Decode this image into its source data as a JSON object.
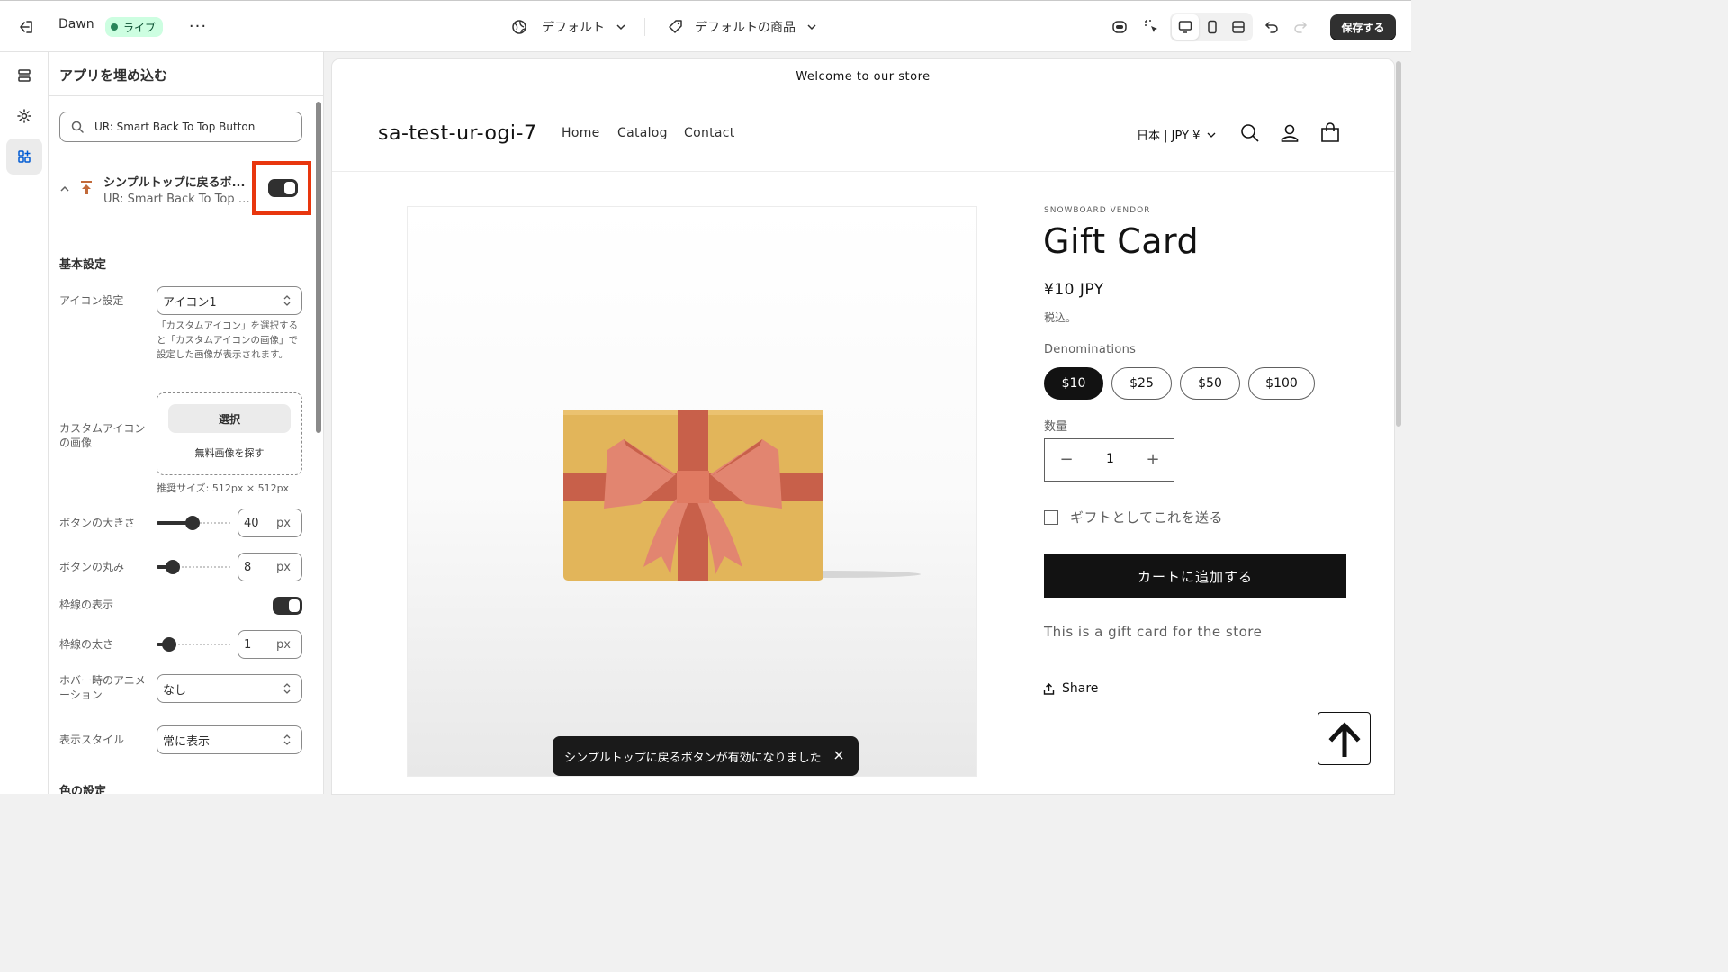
{
  "topbar": {
    "theme_name": "Dawn",
    "live_badge": "ライブ",
    "more": "···",
    "context_default": "デフォルト",
    "context_product": "デフォルトの商品",
    "save_label": "保存する"
  },
  "panel": {
    "title": "アプリを埋め込む",
    "search_value": "UR: Smart Back To Top Button",
    "app": {
      "title": "シンプルトップに戻るボ...",
      "subtitle": "UR: Smart Back To Top B...",
      "enabled": true
    },
    "basic_section": "基本設定",
    "icon_setting_label": "アイコン設定",
    "icon_setting_value": "アイコン1",
    "icon_help": "「カスタムアイコン」を選択すると「カスタムアイコンの画像」で設定した画像が表示されます。",
    "custom_icon_label": "カスタムアイコンの画像",
    "select_button": "選択",
    "free_images_link": "無料画像を探す",
    "recommended_size": "推奨サイズ: 512px × 512px",
    "button_size_label": "ボタンの大きさ",
    "button_size_value": "40",
    "button_radius_label": "ボタンの丸み",
    "button_radius_value": "8",
    "border_show_label": "枠線の表示",
    "border_show": true,
    "border_width_label": "枠線の太さ",
    "border_width_value": "1",
    "unit_px": "px",
    "hover_anim_label": "ホバー時のアニメーション",
    "hover_anim_value": "なし",
    "display_style_label": "表示スタイル",
    "display_style_value": "常に表示",
    "color_section": "色の設定"
  },
  "preview": {
    "announcement": "Welcome to our store",
    "store_name": "sa-test-ur-ogi-7",
    "nav": [
      "Home",
      "Catalog",
      "Contact"
    ],
    "currency": "日本 | JPY ¥",
    "vendor": "SNOWBOARD VENDOR",
    "product_title": "Gift Card",
    "price": "¥10 JPY",
    "tax_note": "税込。",
    "option_label": "Denominations",
    "denominations": [
      "$10",
      "$25",
      "$50",
      "$100"
    ],
    "selected_denomination": "$10",
    "quantity_label": "数量",
    "quantity": "1",
    "qty_minus": "−",
    "qty_plus": "+",
    "gift_checkbox_label": "ギフトとしてこれを送る",
    "add_to_cart": "カートに追加する",
    "description": "This is a gift card for the store",
    "share": "Share"
  },
  "toast": {
    "message": "シンプルトップに戻るボタンが有効になりました"
  },
  "colors": {
    "live_green": "#29845a",
    "highlight_red": "#e8360e",
    "gift_gold": "#e2b55a",
    "ribbon_red": "#c8604a",
    "bow_pink": "#e28570"
  }
}
